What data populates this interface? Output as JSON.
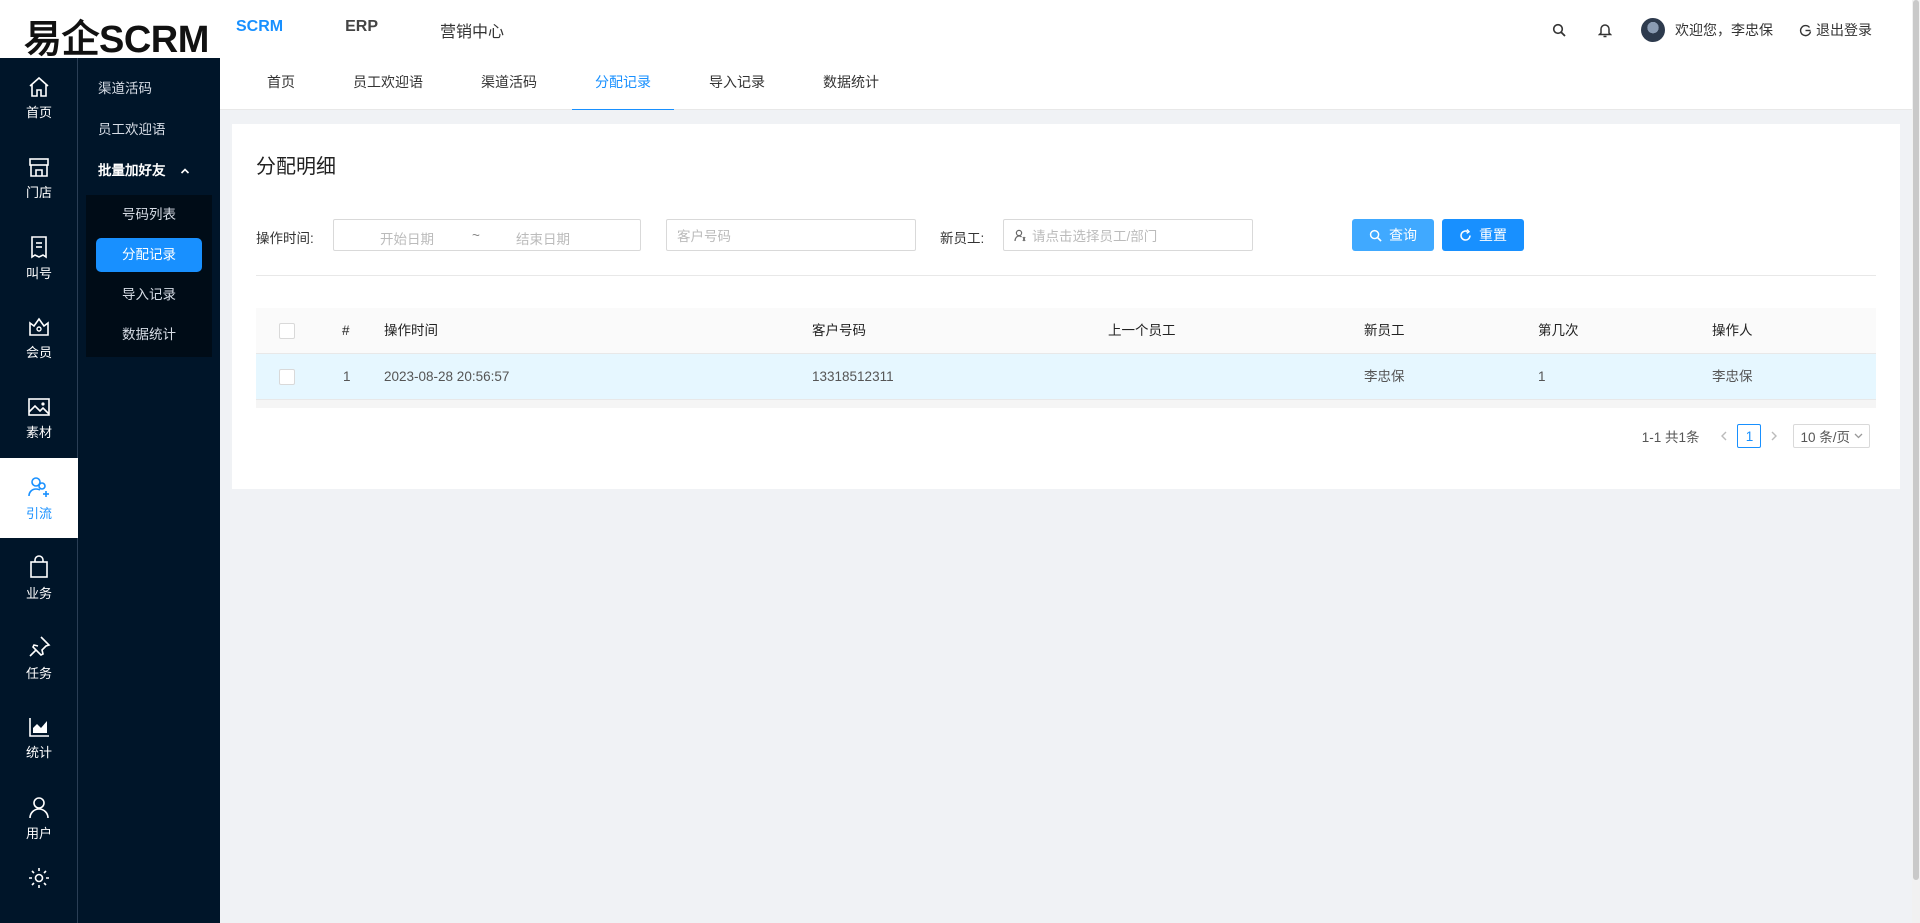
{
  "header": {
    "logo": "易企SCRM",
    "nav": [
      {
        "label": "SCRM",
        "active": true
      },
      {
        "label": "ERP",
        "active": false
      },
      {
        "label": "营销中心",
        "active": false
      }
    ],
    "welcome": "欢迎您，李忠保",
    "logout": "退出登录"
  },
  "iconbar": {
    "items": [
      {
        "label": "首页",
        "icon": "home-icon"
      },
      {
        "label": "门店",
        "icon": "store-icon"
      },
      {
        "label": "叫号",
        "icon": "queue-icon"
      },
      {
        "label": "会员",
        "icon": "member-icon"
      },
      {
        "label": "素材",
        "icon": "image-icon"
      },
      {
        "label": "引流",
        "icon": "users-add-icon",
        "active": true
      },
      {
        "label": "业务",
        "icon": "bag-icon"
      },
      {
        "label": "任务",
        "icon": "pin-icon"
      },
      {
        "label": "统计",
        "icon": "chart-icon"
      },
      {
        "label": "用户",
        "icon": "user-icon"
      }
    ]
  },
  "subbar": {
    "items": [
      "渠道活码",
      "员工欢迎语"
    ],
    "group": {
      "label": "批量加好友",
      "children": [
        "号码列表",
        "分配记录",
        "导入记录",
        "数据统计"
      ],
      "active_index": 1
    }
  },
  "tabs": [
    {
      "label": "首页"
    },
    {
      "label": "员工欢迎语"
    },
    {
      "label": "渠道活码"
    },
    {
      "label": "分配记录",
      "active": true
    },
    {
      "label": "导入记录"
    },
    {
      "label": "数据统计"
    }
  ],
  "card": {
    "title": "分配明细",
    "filters": {
      "time_label": "操作时间:",
      "start_placeholder": "开始日期",
      "range_sep": "~",
      "end_placeholder": "结束日期",
      "customer_placeholder": "客户号码",
      "staff_label": "新员工:",
      "staff_placeholder": "请点击选择员工/部门",
      "query_label": "查询",
      "reset_label": "重置"
    },
    "table": {
      "columns": [
        "#",
        "操作时间",
        "客户号码",
        "上一个员工",
        "新员工",
        "第几次",
        "操作人"
      ],
      "rows": [
        {
          "index": "1",
          "time": "2023-08-28 20:56:57",
          "customer": "13318512311",
          "prev_staff": "",
          "new_staff": "李忠保",
          "times": "1",
          "operator": "李忠保"
        }
      ]
    },
    "pagination": {
      "total": "1-1 共1条",
      "current": "1",
      "page_size": "10 条/页"
    }
  },
  "colors": {
    "primary": "#1890ff",
    "sidebar": "#001529",
    "row_highlight": "#e6f7ff"
  }
}
